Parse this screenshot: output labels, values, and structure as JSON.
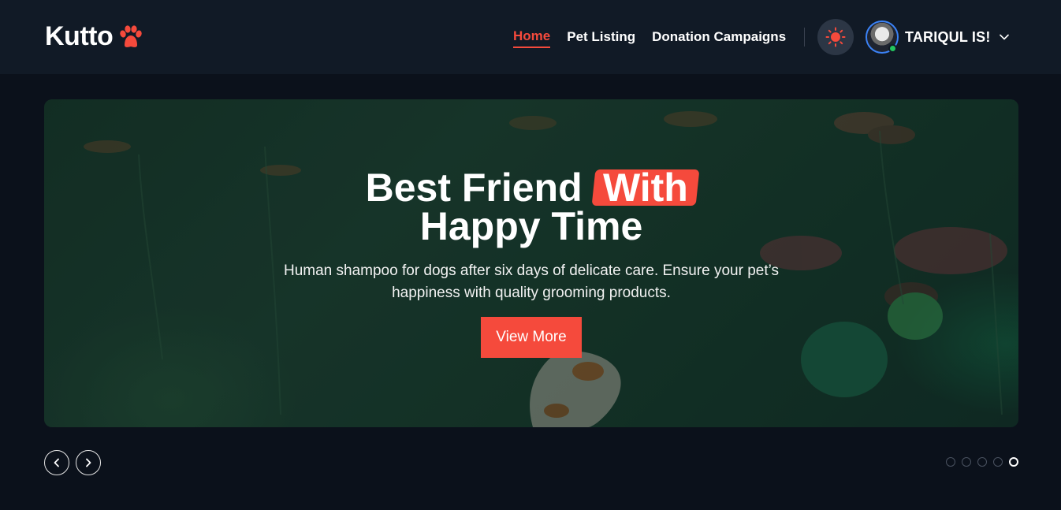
{
  "header": {
    "brand": "Kutto",
    "nav": [
      {
        "label": "Home",
        "active": true
      },
      {
        "label": "Pet Listing",
        "active": false
      },
      {
        "label": "Donation Campaigns",
        "active": false
      }
    ],
    "theme_icon": "sun-icon",
    "user": {
      "name": "TARIQUL IS!",
      "status": "online",
      "menu_icon": "chevron-down-icon"
    }
  },
  "hero": {
    "title_part1": "Best Friend ",
    "title_highlight": "With",
    "title_line2": "Happy Time",
    "subtitle": "Human shampoo for dogs after six days of delicate care. Ensure your pet’s happiness with quality grooming products.",
    "cta_label": "View More"
  },
  "slider": {
    "prev_icon": "chevron-left-icon",
    "next_icon": "chevron-right-icon",
    "slide_count": 5,
    "active_index": 4
  },
  "colors": {
    "accent": "#f54a3c",
    "background": "#0b111b",
    "header": "#111a26",
    "online": "#22c55e"
  }
}
